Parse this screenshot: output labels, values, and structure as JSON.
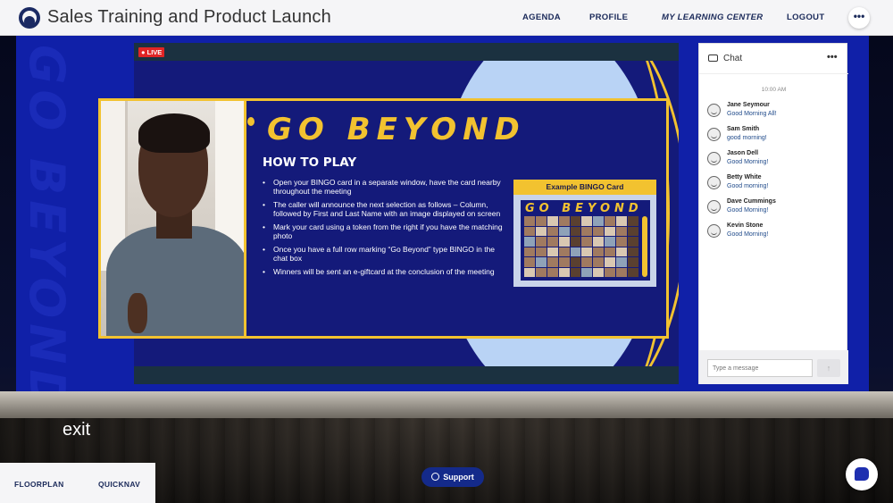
{
  "header": {
    "title": "Sales Training and Product Launch",
    "nav": [
      "AGENDA",
      "PROFILE",
      "MY LEARNING CENTER",
      "LOGOUT"
    ],
    "more_label": "•••"
  },
  "stage": {
    "backdrop_text": "GO BEYOND",
    "live_label": "LIVE"
  },
  "slide": {
    "title": "GO BEYOND",
    "subtitle": "HOW TO PLAY",
    "rules": [
      "Open your BINGO card in a separate window, have the card nearby throughout the meeting",
      "The caller will announce the next selection as follows – Column, followed by First and Last Name with an image displayed on screen",
      "Mark your card using a token from the right if you have the matching photo",
      "Once you have a full row marking “Go Beyond” type BINGO in the chat box",
      "Winners will be sent an e-giftcard at the conclusion of the meeting"
    ],
    "card_title": "Example BINGO Card",
    "card_banner": "GO BEYOND"
  },
  "chat": {
    "title": "Chat",
    "more_label": "•••",
    "time": "10:00 AM",
    "messages": [
      {
        "name": "Jane Seymour",
        "text": "Good Morning All!"
      },
      {
        "name": "Sam Smith",
        "text": "good morning!"
      },
      {
        "name": "Jason Dell",
        "text": "Good Morning!"
      },
      {
        "name": "Betty White",
        "text": "Good morning!"
      },
      {
        "name": "Dave Cummings",
        "text": "Good Morning!"
      },
      {
        "name": "Kevin Stone",
        "text": "Good Morning!"
      }
    ],
    "input_placeholder": "Type a message",
    "send_label": "↑"
  },
  "bottom": {
    "exit_label": "exit",
    "floorplan_label": "FLOORPLAN",
    "quicknav_label": "QUICKNAV",
    "support_label": "Support"
  }
}
